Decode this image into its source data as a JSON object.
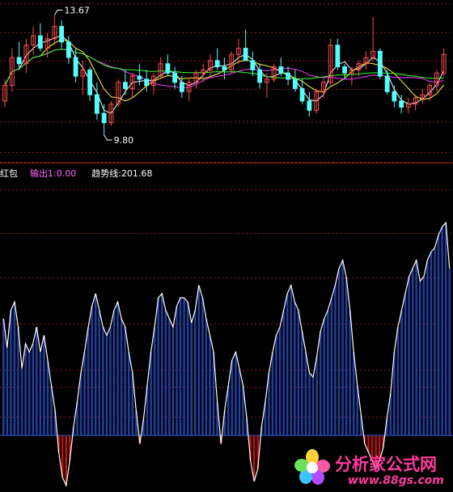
{
  "price_panel": {
    "high_label": "13.67",
    "low_label": "9.80",
    "high": 13.67,
    "low": 9.8
  },
  "indicator_header": {
    "name": "红包",
    "output_label": "输出1:",
    "output_value": "0.00",
    "trend_label": "趋势线:",
    "trend_value": "201.68"
  },
  "watermark": {
    "text": "分析家公式网",
    "url": "www.88gs.com"
  },
  "colors": {
    "up": "#ff4d4d",
    "down": "#54ffff",
    "bar_pos": "#1f3fa0",
    "bar_neg": "#c01010",
    "line": "#ffffff",
    "grid": "#8a1a1a",
    "ma_white": "#ffffff",
    "ma_yellow": "#ffff33",
    "ma_magenta": "#ff33ff",
    "ma_green": "#33ff33",
    "accent_magenta": "#ff66ff"
  },
  "chart_data": [
    {
      "type": "candlestick",
      "title": "",
      "annotations": [
        "13.67",
        "9.80"
      ],
      "ylim": [
        9.2,
        14.1
      ],
      "series": [
        {
          "name": "",
          "values": [
            [
              10.9,
              11.6,
              10.7,
              11.4
            ],
            [
              11.4,
              12.6,
              11.2,
              12.3
            ],
            [
              12.3,
              12.8,
              11.9,
              12.1
            ],
            [
              12.1,
              12.9,
              11.8,
              12.7
            ],
            [
              12.7,
              13.3,
              12.4,
              13.0
            ],
            [
              13.0,
              13.4,
              12.5,
              12.6
            ],
            [
              12.6,
              13.1,
              12.3,
              12.9
            ],
            [
              12.9,
              13.67,
              12.7,
              13.3
            ],
            [
              13.3,
              13.5,
              12.6,
              12.8
            ],
            [
              12.8,
              13.0,
              12.1,
              12.3
            ],
            [
              12.3,
              12.6,
              11.5,
              11.7
            ],
            [
              11.7,
              12.2,
              11.1,
              11.9
            ],
            [
              11.9,
              12.0,
              10.9,
              11.1
            ],
            [
              11.1,
              11.5,
              10.3,
              10.5
            ],
            [
              10.5,
              10.8,
              9.8,
              10.2
            ],
            [
              10.2,
              10.9,
              10.1,
              10.8
            ],
            [
              10.8,
              11.6,
              10.7,
              11.5
            ],
            [
              11.5,
              11.9,
              11.1,
              11.3
            ],
            [
              11.3,
              11.8,
              11.0,
              11.7
            ],
            [
              11.7,
              12.1,
              11.4,
              11.6
            ],
            [
              11.6,
              11.9,
              11.2,
              11.4
            ],
            [
              11.4,
              11.8,
              11.1,
              11.7
            ],
            [
              11.7,
              12.3,
              11.6,
              12.1
            ],
            [
              12.1,
              12.4,
              11.7,
              11.8
            ],
            [
              11.8,
              12.0,
              11.3,
              11.5
            ],
            [
              11.5,
              11.7,
              11.0,
              11.2
            ],
            [
              11.2,
              11.6,
              10.9,
              11.5
            ],
            [
              11.5,
              11.9,
              11.3,
              11.8
            ],
            [
              11.8,
              12.1,
              11.5,
              11.9
            ],
            [
              11.9,
              12.4,
              11.7,
              12.2
            ],
            [
              12.2,
              12.6,
              11.9,
              12.0
            ],
            [
              12.0,
              12.3,
              11.6,
              11.9
            ],
            [
              11.9,
              12.5,
              11.8,
              12.4
            ],
            [
              12.4,
              12.9,
              12.1,
              12.6
            ],
            [
              12.6,
              13.2,
              12.4,
              12.2
            ],
            [
              12.2,
              12.5,
              11.7,
              11.9
            ],
            [
              11.9,
              12.1,
              11.3,
              11.5
            ],
            [
              11.5,
              11.8,
              11.0,
              11.6
            ],
            [
              11.6,
              12.1,
              11.5,
              12.0
            ],
            [
              12.0,
              12.3,
              11.7,
              11.8
            ],
            [
              11.8,
              12.0,
              11.4,
              11.6
            ],
            [
              11.6,
              11.9,
              11.2,
              11.3
            ],
            [
              11.3,
              11.6,
              10.8,
              10.9
            ],
            [
              10.9,
              11.2,
              10.4,
              10.6
            ],
            [
              10.6,
              11.3,
              10.5,
              11.2
            ],
            [
              11.2,
              11.6,
              11.0,
              11.5
            ],
            [
              11.5,
              12.9,
              11.4,
              12.7
            ],
            [
              12.7,
              12.9,
              11.9,
              12.0
            ],
            [
              12.0,
              12.1,
              11.6,
              11.8
            ],
            [
              11.8,
              12.0,
              11.4,
              11.9
            ],
            [
              11.9,
              12.2,
              11.7,
              12.1
            ],
            [
              12.1,
              12.5,
              11.9,
              12.3
            ],
            [
              12.3,
              13.6,
              12.2,
              12.5
            ],
            [
              12.5,
              12.6,
              11.6,
              11.7
            ],
            [
              11.7,
              11.9,
              11.1,
              11.2
            ],
            [
              11.2,
              11.4,
              10.7,
              10.9
            ],
            [
              10.9,
              11.1,
              10.5,
              10.7
            ],
            [
              10.7,
              11.0,
              10.5,
              10.8
            ],
            [
              10.8,
              11.1,
              10.6,
              11.0
            ],
            [
              11.0,
              11.3,
              10.8,
              11.1
            ],
            [
              11.1,
              11.5,
              10.9,
              11.4
            ],
            [
              11.4,
              11.9,
              11.2,
              11.8
            ],
            [
              11.8,
              12.6,
              11.7,
              12.4
            ]
          ]
        }
      ]
    },
    {
      "type": "bar",
      "title": "",
      "ylim": [
        -120,
        520
      ],
      "series": [
        {
          "name": "输出1",
          "values": [
            280,
            210,
            300,
            320,
            260,
            160,
            220,
            200,
            220,
            260,
            200,
            240,
            180,
            120,
            60,
            -40,
            -100,
            -120,
            -60,
            20,
            80,
            150,
            200,
            260,
            310,
            340,
            300,
            260,
            240,
            260,
            300,
            320,
            280,
            260,
            200,
            150,
            60,
            -20,
            40,
            120,
            200,
            260,
            330,
            340,
            300,
            280,
            260,
            310,
            330,
            330,
            320,
            270,
            300,
            360,
            330,
            280,
            240,
            200,
            80,
            -20,
            60,
            120,
            180,
            200,
            160,
            120,
            40,
            -60,
            -110,
            -80,
            20,
            80,
            150,
            200,
            240,
            260,
            300,
            340,
            360,
            320,
            300,
            250,
            200,
            150,
            140,
            190,
            250,
            280,
            300,
            330,
            360,
            400,
            420,
            380,
            300,
            200,
            120,
            50,
            -20,
            -40,
            -60,
            -80,
            -60,
            -30,
            40,
            100,
            200,
            260,
            300,
            340,
            380,
            400,
            420,
            370,
            380,
            420,
            440,
            450,
            480,
            500,
            510,
            400
          ]
        }
      ]
    }
  ]
}
